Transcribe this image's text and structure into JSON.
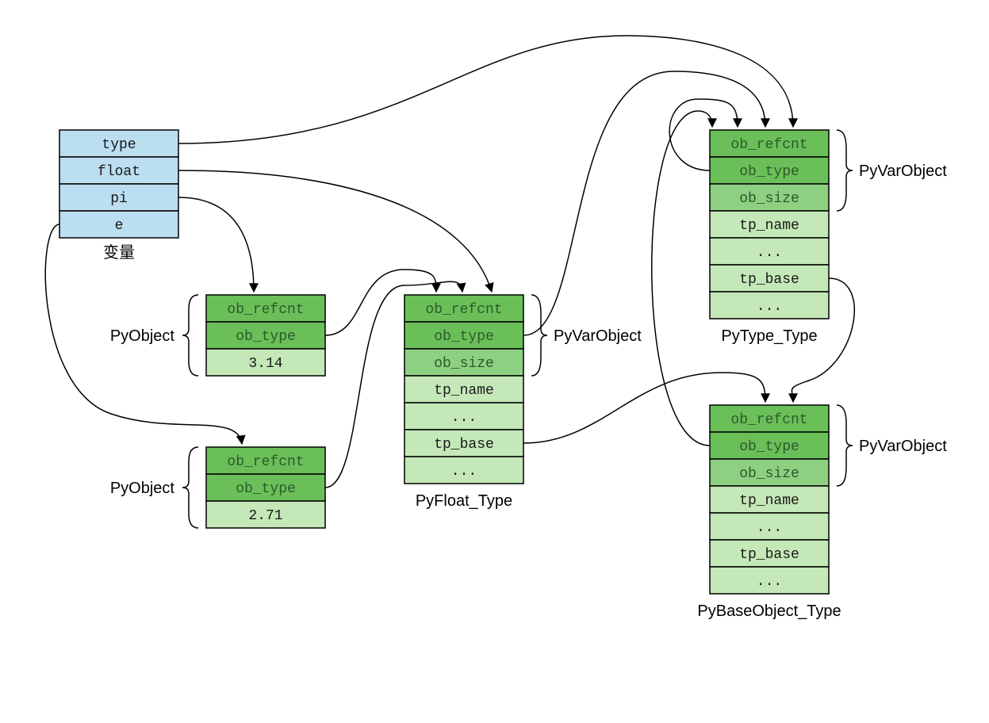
{
  "vars": {
    "cells": [
      "type",
      "float",
      "pi",
      "e"
    ],
    "caption": "变量"
  },
  "piObj": {
    "cells": [
      "ob_refcnt",
      "ob_type",
      "3.14"
    ],
    "label": "PyObject"
  },
  "eObj": {
    "cells": [
      "ob_refcnt",
      "ob_type",
      "2.71"
    ],
    "label": "PyObject"
  },
  "floatType": {
    "cells": [
      "ob_refcnt",
      "ob_type",
      "ob_size",
      "tp_name",
      "...",
      "tp_base",
      "..."
    ],
    "caption": "PyFloat_Type",
    "label": "PyVarObject"
  },
  "typeType": {
    "cells": [
      "ob_refcnt",
      "ob_type",
      "ob_size",
      "tp_name",
      "...",
      "tp_base",
      "..."
    ],
    "caption": "PyType_Type",
    "label": "PyVarObject"
  },
  "baseType": {
    "cells": [
      "ob_refcnt",
      "ob_type",
      "ob_size",
      "tp_name",
      "...",
      "tp_base",
      "..."
    ],
    "caption": "PyBaseObject_Type",
    "label": "PyVarObject"
  }
}
